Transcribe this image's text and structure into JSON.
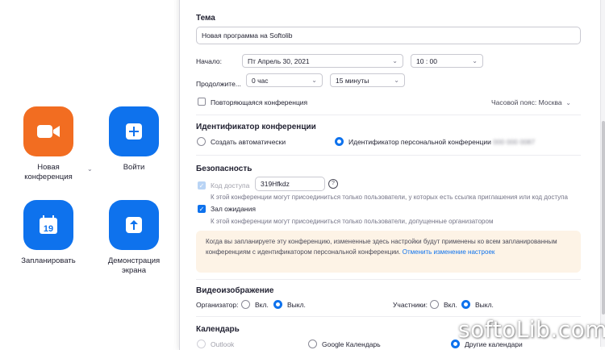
{
  "home": {
    "new_meeting": "Новая конференция",
    "join": "Войти",
    "schedule": "Запланировать",
    "calendar_day": "19",
    "share_screen": "Демонстрация экрана"
  },
  "dialog": {
    "topic_heading": "Тема",
    "topic_value": "Новая программа на Softolib",
    "start_label": "Начало:",
    "start_date": "Пт  Апрель  30,  2021",
    "start_time": "10 : 00",
    "duration_label": "Продолжите...",
    "duration_hours": "0 час",
    "duration_minutes": "15 минуты",
    "recurring_label": "Повторяющаяся конференция",
    "timezone_label": "Часовой пояс: Москва",
    "meeting_id_heading": "Идентификатор конференции",
    "auto_generate_label": "Создать автоматически",
    "personal_id_label": "Идентификатор персональной конференции",
    "personal_id_value": "000 000 0087",
    "security_heading": "Безопасность",
    "passcode_label": "Код доступа",
    "passcode_value": "319Hfkdz",
    "passcode_hint": "К этой конференции могут присоединиться только пользователи, у которых есть ссылка приглашения или код доступа",
    "waiting_room_label": "Зал ожидания",
    "waiting_room_hint": "К этой конференции могут присоединиться только пользователи, допущенные организатором",
    "notice_text": "Когда вы запланируете эту конференцию, измененные здесь настройки будут применены ко всем запланированным конференциям с идентификатором персональной конференции.",
    "notice_link": "Отменить изменение настроек",
    "video_heading": "Видеоизображение",
    "host_label": "Организатор:",
    "participants_label": "Участники:",
    "on_label": "Вкл.",
    "off_label": "Выкл.",
    "calendar_heading": "Календарь",
    "calendar_outlook": "Outlook",
    "calendar_google": "Google Календарь",
    "calendar_other": "Другие календари"
  },
  "watermark": "softoLib.com",
  "colors": {
    "accent": "#0e72ed",
    "orange": "#f26d21",
    "notice_bg": "#fdf3e6"
  }
}
